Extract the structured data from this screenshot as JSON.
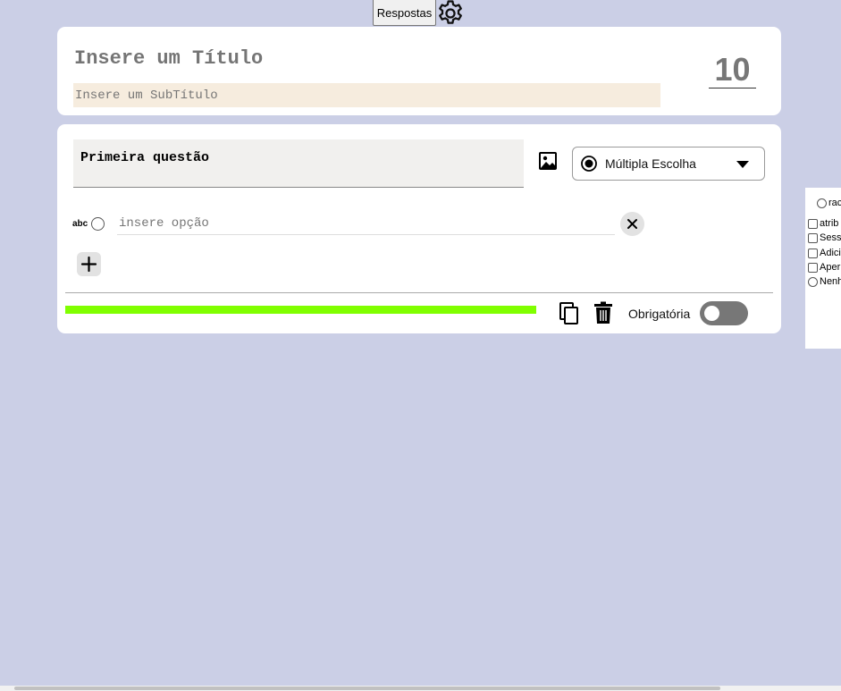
{
  "topbar": {
    "responses_label": "Respostas",
    "settings_icon": "gear-icon"
  },
  "header": {
    "title_placeholder": "Insere um Título",
    "subtitle_placeholder": "Insere um SubTítulo",
    "score": "10"
  },
  "question": {
    "text": "Primeira questão",
    "image_icon": "image-icon",
    "type_label": "Múltipla Escolha",
    "option_prefix": "abc",
    "option_placeholder": "insere opção",
    "progress_fraction": 1.0,
    "required_label": "Obrigatória",
    "required_on": false
  },
  "side_panel": {
    "items": [
      {
        "kind": "radio",
        "label": "rac"
      },
      {
        "kind": "checkbox",
        "label": "atrib"
      },
      {
        "kind": "checkbox",
        "label": "Sess"
      },
      {
        "kind": "checkbox",
        "label": "Adici"
      },
      {
        "kind": "checkbox",
        "label": "Aper"
      },
      {
        "kind": "radio",
        "label": "Nenh"
      }
    ]
  },
  "colors": {
    "background": "#cbcfe6",
    "progress": "#80ff00",
    "subtitle_bg": "#f6ecde",
    "toggle_off": "#777777"
  }
}
